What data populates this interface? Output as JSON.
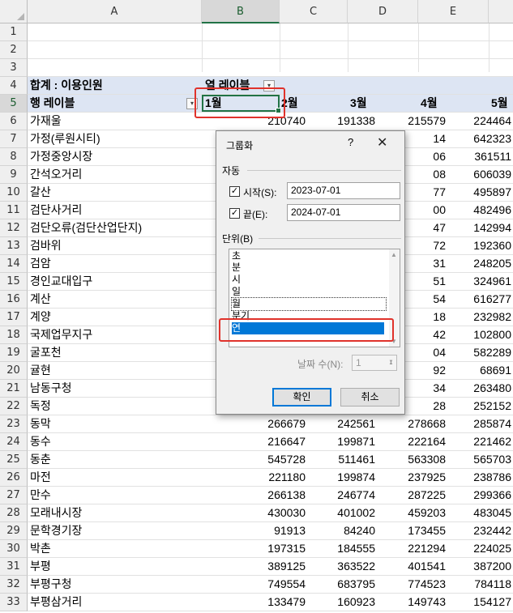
{
  "columns": [
    "A",
    "B",
    "C",
    "D",
    "E"
  ],
  "row_numbers": [
    "1",
    "2",
    "3",
    "4",
    "5",
    "6",
    "7",
    "8",
    "9",
    "10",
    "11",
    "12",
    "13",
    "14",
    "15",
    "16",
    "17",
    "18",
    "19",
    "20",
    "21",
    "22",
    "23",
    "24",
    "25",
    "26",
    "27",
    "28",
    "29",
    "30",
    "31",
    "32",
    "33"
  ],
  "pivot": {
    "sum_label": "합계 : 이용인원",
    "col_label_header": "열 레이블",
    "row_label_header": "행 레이블",
    "months": [
      "1월",
      "2월",
      "3월",
      "4월",
      "5월"
    ],
    "rows": [
      {
        "name": "가재울",
        "b": "210740",
        "c": "191338",
        "d": "215579",
        "e": "224464"
      },
      {
        "name": "가정(루원시티)",
        "b": "",
        "c": "",
        "d": "14",
        "e": "642323"
      },
      {
        "name": "가정중앙시장",
        "b": "",
        "c": "",
        "d": "06",
        "e": "361511"
      },
      {
        "name": "간석오거리",
        "b": "",
        "c": "",
        "d": "08",
        "e": "606039"
      },
      {
        "name": "갈산",
        "b": "",
        "c": "",
        "d": "77",
        "e": "495897"
      },
      {
        "name": "검단사거리",
        "b": "",
        "c": "",
        "d": "00",
        "e": "482496"
      },
      {
        "name": "검단오류(검단산업단지)",
        "b": "",
        "c": "",
        "d": "47",
        "e": "142994"
      },
      {
        "name": "검바위",
        "b": "",
        "c": "",
        "d": "72",
        "e": "192360"
      },
      {
        "name": "검암",
        "b": "",
        "c": "",
        "d": "31",
        "e": "248205"
      },
      {
        "name": "경인교대입구",
        "b": "",
        "c": "",
        "d": "51",
        "e": "324961"
      },
      {
        "name": "계산",
        "b": "",
        "c": "",
        "d": "54",
        "e": "616277"
      },
      {
        "name": "계양",
        "b": "",
        "c": "",
        "d": "18",
        "e": "232982"
      },
      {
        "name": "국제업무지구",
        "b": "",
        "c": "",
        "d": "42",
        "e": "102800"
      },
      {
        "name": "굴포천",
        "b": "",
        "c": "",
        "d": "04",
        "e": "582289"
      },
      {
        "name": "귤현",
        "b": "",
        "c": "",
        "d": "92",
        "e": "68691"
      },
      {
        "name": "남동구청",
        "b": "",
        "c": "",
        "d": "34",
        "e": "263480"
      },
      {
        "name": "독정",
        "b": "",
        "c": "",
        "d": "28",
        "e": "252152"
      },
      {
        "name": "동막",
        "b": "266679",
        "c": "242561",
        "d": "278668",
        "e": "285874"
      },
      {
        "name": "동수",
        "b": "216647",
        "c": "199871",
        "d": "222164",
        "e": "221462"
      },
      {
        "name": "동춘",
        "b": "545728",
        "c": "511461",
        "d": "563308",
        "e": "565703"
      },
      {
        "name": "마전",
        "b": "221180",
        "c": "199874",
        "d": "237925",
        "e": "238786"
      },
      {
        "name": "만수",
        "b": "266138",
        "c": "246774",
        "d": "287225",
        "e": "299366"
      },
      {
        "name": "모래내시장",
        "b": "430030",
        "c": "401002",
        "d": "459203",
        "e": "483045"
      },
      {
        "name": "문학경기장",
        "b": "91913",
        "c": "84240",
        "d": "173455",
        "e": "232442"
      },
      {
        "name": "박촌",
        "b": "197315",
        "c": "184555",
        "d": "221294",
        "e": "224025"
      },
      {
        "name": "부평",
        "b": "389125",
        "c": "363522",
        "d": "401541",
        "e": "387200"
      },
      {
        "name": "부평구청",
        "b": "749554",
        "c": "683795",
        "d": "774523",
        "e": "784118"
      },
      {
        "name": "부평삼거리",
        "b": "133479",
        "c": "160923",
        "d": "149743",
        "e": "154127"
      }
    ]
  },
  "dialog": {
    "title": "그룹화",
    "help": "?",
    "close": "✕",
    "auto_group": "자동",
    "start_label": "시작(S):",
    "start_value": "2023-07-01",
    "end_label": "끝(E):",
    "end_value": "2024-07-01",
    "unit_group": "단위(B)",
    "units": [
      "초",
      "분",
      "시",
      "일",
      "월",
      "분기",
      "연"
    ],
    "days_label": "날짜 수(N):",
    "days_value": "1",
    "ok": "확인",
    "cancel": "취소"
  },
  "colors": {
    "accent": "#217346",
    "pivot_header": "#dde5f3",
    "highlight_red": "#e0322b",
    "selection_blue": "#0078d7"
  },
  "icons": {
    "filter": "dropdown-filter-icon",
    "checked": "checkmark-icon"
  }
}
